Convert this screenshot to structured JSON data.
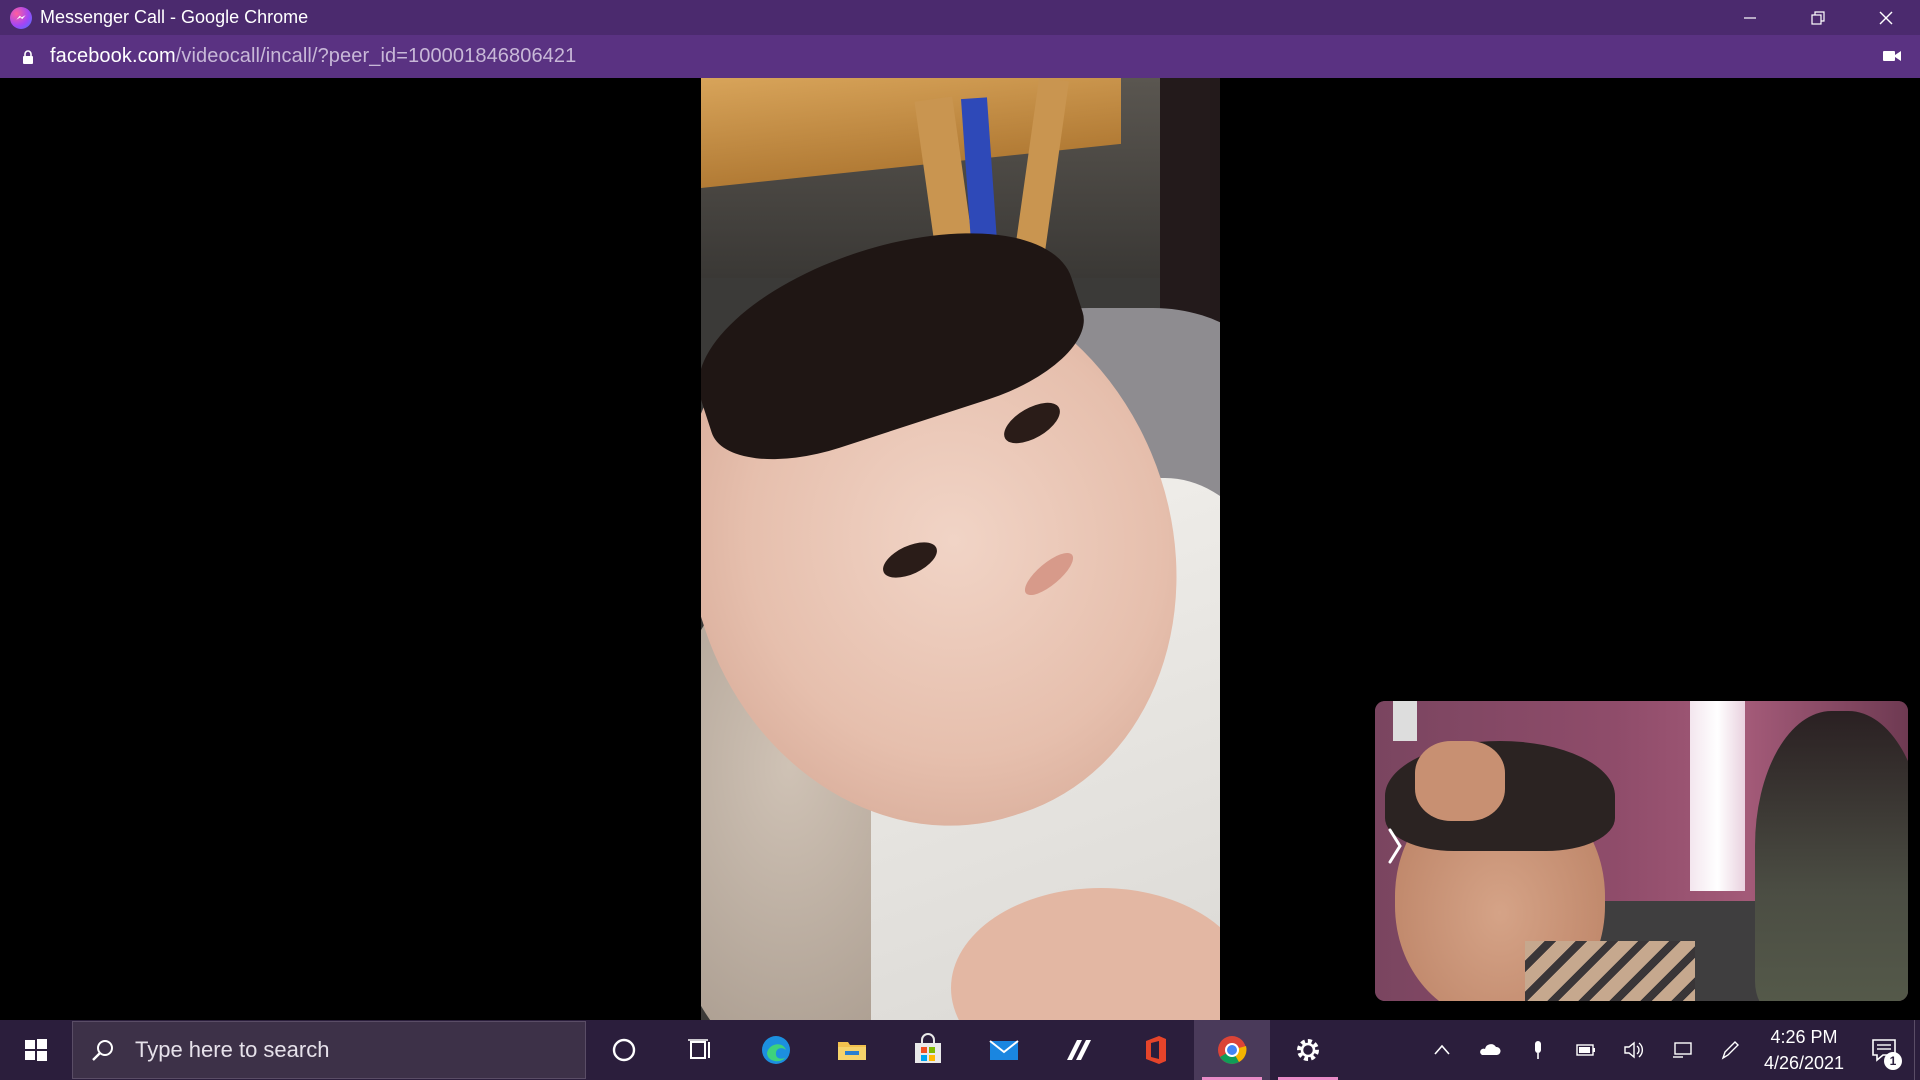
{
  "window": {
    "title": "Messenger Call - Google Chrome",
    "url_host": "facebook.com",
    "url_path": "/videocall/incall/?peer_id=100001846806421"
  },
  "taskbar": {
    "search_placeholder": "Type here to search",
    "pinned": [
      "cortana-icon",
      "task-view-icon",
      "edge-icon",
      "file-explorer-icon",
      "microsoft-store-icon",
      "mail-icon",
      "app-icon",
      "office-icon",
      "chrome-icon",
      "settings-icon"
    ],
    "clock_time": "4:26 PM",
    "clock_date": "4/26/2021",
    "notification_count": "1"
  },
  "colors": {
    "titlebar": "#4b2a6e",
    "addressbar": "#5a3282",
    "taskbar": "#2b1e3c",
    "accent": "#e98bc7"
  }
}
